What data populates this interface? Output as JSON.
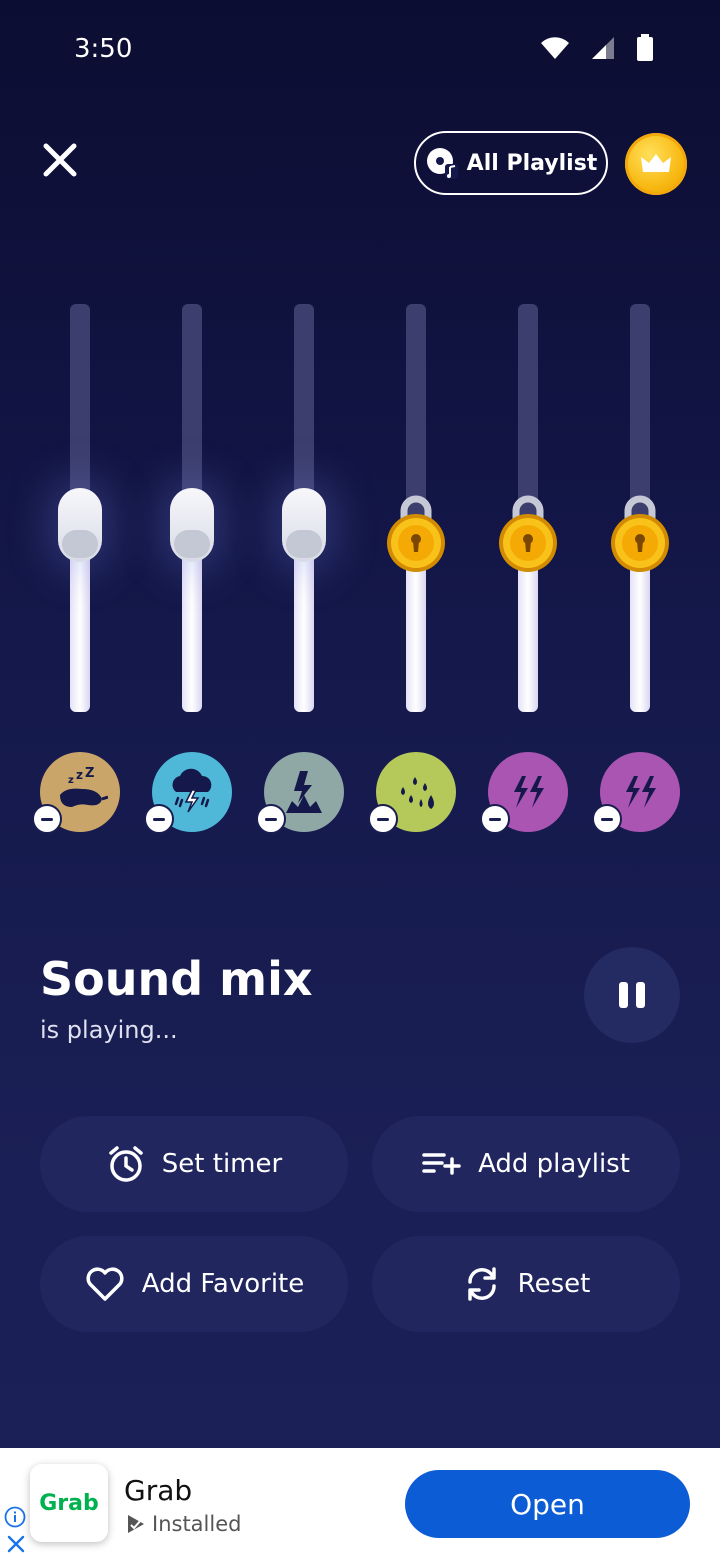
{
  "status_bar": {
    "time": "3:50"
  },
  "header": {
    "playlist_label": "All Playlist"
  },
  "sliders": [
    {
      "level": 0.45,
      "locked": false
    },
    {
      "level": 0.45,
      "locked": false
    },
    {
      "level": 0.45,
      "locked": false
    },
    {
      "level": 0.45,
      "locked": true
    },
    {
      "level": 0.45,
      "locked": true
    },
    {
      "level": 0.45,
      "locked": true
    }
  ],
  "sounds": [
    {
      "icon": "sleep-mask-icon",
      "color": "#c9a56a"
    },
    {
      "icon": "thunderstorm-rain-icon",
      "color": "#4fb8d8"
    },
    {
      "icon": "lightning-strike-icon",
      "color": "#8fa8a6"
    },
    {
      "icon": "rain-drops-icon",
      "color": "#b5c85a"
    },
    {
      "icon": "lightning-bolts-icon",
      "color": "#ab55b3"
    },
    {
      "icon": "lightning-bolts-icon",
      "color": "#ab55b3"
    }
  ],
  "player": {
    "title": "Sound mix",
    "subtitle": "is playing..."
  },
  "actions": {
    "set_timer": "Set timer",
    "add_playlist": "Add playlist",
    "add_favorite": "Add Favorite",
    "reset": "Reset"
  },
  "ad": {
    "logo_text": "Grab",
    "app_name": "Grab",
    "status": "Installed",
    "cta": "Open"
  },
  "colors": {
    "accent_gold": "#f8b812",
    "button_bg": "#21275e",
    "ad_cta": "#0b5cd5"
  }
}
